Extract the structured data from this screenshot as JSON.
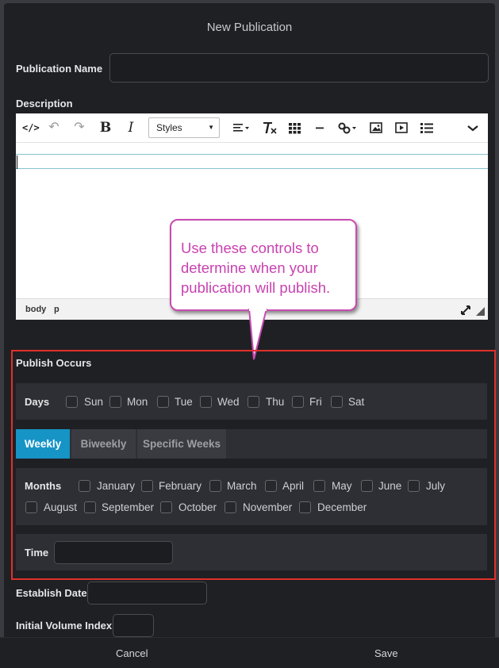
{
  "dialog": {
    "title": "New Publication"
  },
  "fields": {
    "publication_name_label": "Publication Name",
    "description_label": "Description",
    "establish_date_label": "Establish Date",
    "initial_volume_label": "Initial Volume Index"
  },
  "editor": {
    "styles_label": "Styles",
    "status_path": [
      "body",
      "p"
    ]
  },
  "callout": {
    "text": "Use these controls to determine when your publication will publish."
  },
  "publish": {
    "title": "Publish Occurs",
    "days_label": "Days",
    "days": [
      "Sun",
      "Mon",
      "Tue",
      "Wed",
      "Thu",
      "Fri",
      "Sat"
    ],
    "tabs": [
      "Weekly",
      "Biweekly",
      "Specific Weeks"
    ],
    "active_tab": "Weekly",
    "months_label": "Months",
    "months": [
      "January",
      "February",
      "March",
      "April",
      "May",
      "June",
      "July",
      "August",
      "September",
      "October",
      "November",
      "December"
    ],
    "time_label": "Time"
  },
  "footer": {
    "cancel": "Cancel",
    "save": "Save"
  },
  "colors": {
    "accent": "#1694c6",
    "highlight": "#e0302a",
    "callout": "#c842b0"
  }
}
